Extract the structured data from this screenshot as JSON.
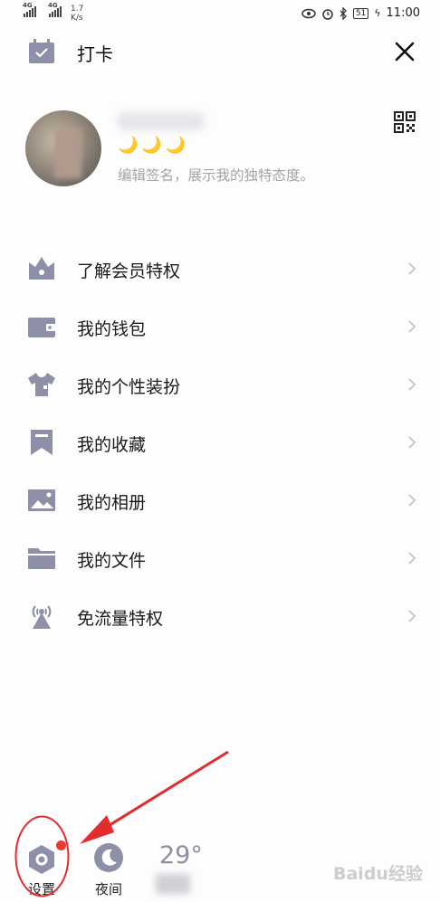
{
  "statusbar": {
    "net1": "4G",
    "net2": "4G",
    "speed_value": "1.7",
    "speed_unit": "K/s",
    "battery": "51",
    "time": "11:00"
  },
  "header": {
    "title": "打卡",
    "icon": "calendar-check-icon"
  },
  "profile": {
    "moons": "🌙🌙🌙",
    "signature": "编辑签名，展示我的独特态度。"
  },
  "menu": {
    "items": [
      {
        "label": "了解会员特权",
        "icon": "crown-icon"
      },
      {
        "label": "我的钱包",
        "icon": "wallet-icon"
      },
      {
        "label": "我的个性装扮",
        "icon": "tshirt-icon"
      },
      {
        "label": "我的收藏",
        "icon": "bookmark-icon"
      },
      {
        "label": "我的相册",
        "icon": "image-icon"
      },
      {
        "label": "我的文件",
        "icon": "folder-icon"
      },
      {
        "label": "免流量特权",
        "icon": "signal-tower-icon"
      }
    ]
  },
  "bottom": {
    "settings_label": "设置",
    "night_label": "夜间",
    "weather": "29°"
  },
  "watermark": "Baidu经验",
  "colors": {
    "icon": "#8d90a8",
    "annotation": "#e52c2c",
    "moon": "#f2b824"
  }
}
